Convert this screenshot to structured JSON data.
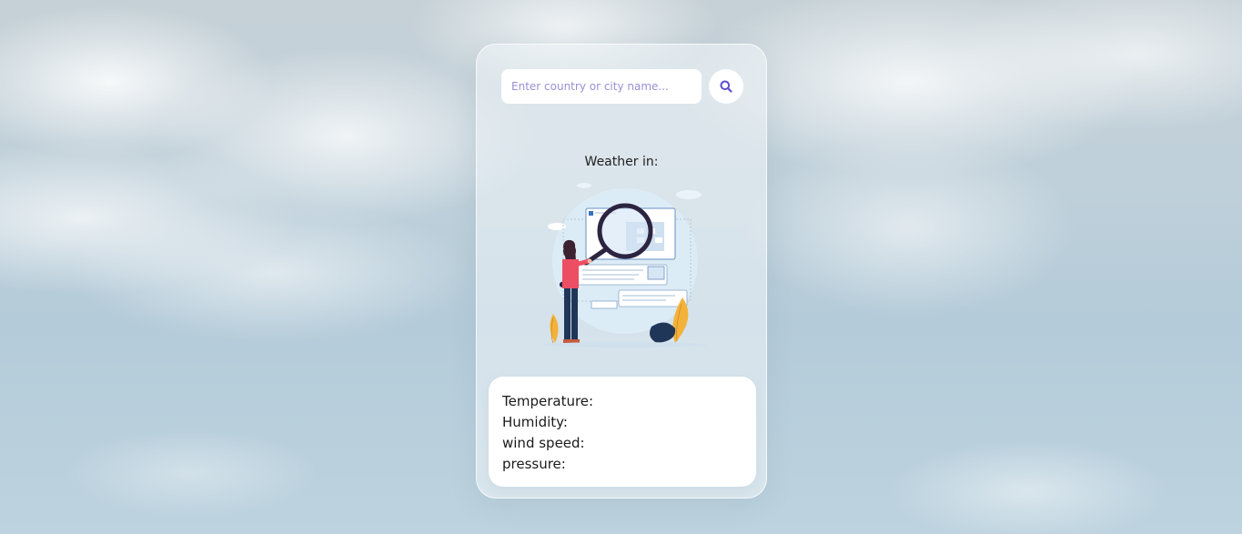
{
  "search": {
    "placeholder": "Enter country or city name...",
    "value": "",
    "button_icon": "search-icon"
  },
  "weather": {
    "title": "Weather in:",
    "illustration": "woman-with-magnifier-illustration"
  },
  "info": {
    "temperature_label": "Temperature:",
    "humidity_label": "Humidity:",
    "wind_speed_label": "wind speed:",
    "pressure_label": "pressure:"
  },
  "colors": {
    "accent": "#5a4fcf",
    "card_bg": "#eef4f7",
    "panel_bg": "#ffffff"
  }
}
